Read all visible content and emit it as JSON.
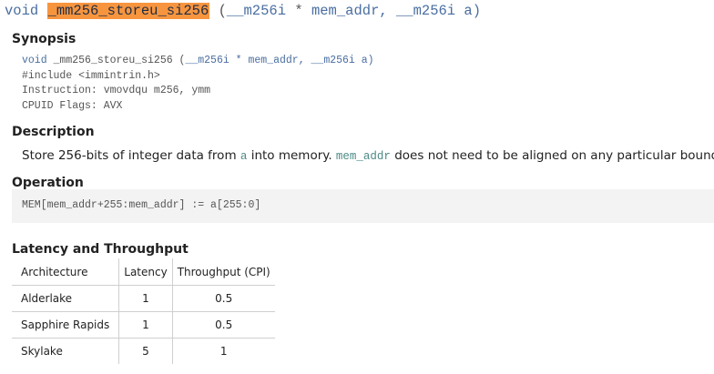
{
  "signature": {
    "ret_type": "void",
    "func_name": "_mm256_storeu_si256",
    "open_paren": "(",
    "param1_type": "__m256i",
    "param1_ptr": "*",
    "param1_name": "mem_addr,",
    "param2_type": "__m256i",
    "param2_name": "a)"
  },
  "synopsis": {
    "heading": "Synopsis",
    "line1_type": "void",
    "line1_name": "_mm256_storeu_si256",
    "line1_open": "(",
    "line1_p1": "__m256i",
    "line1_star": "*",
    "line1_p1name": "mem_addr,",
    "line1_p2": "__m256i",
    "line1_p2name": "a)",
    "include": "#include <immintrin.h>",
    "instruction": "Instruction: vmovdqu m256, ymm",
    "cpuid": "CPUID Flags: AVX"
  },
  "description": {
    "heading": "Description",
    "text_part1": "Store 256-bits of integer data from ",
    "code1": "a",
    "text_part2": " into memory. ",
    "code2": "mem_addr",
    "text_part3": " does not need to be aligned on any particular boundary."
  },
  "operation": {
    "heading": "Operation",
    "code": "MEM[mem_addr+255:mem_addr] := a[255:0]"
  },
  "latency": {
    "heading": "Latency and Throughput",
    "headers": [
      "Architecture",
      "Latency",
      "Throughput (CPI)"
    ],
    "rows": [
      [
        "Alderlake",
        "1",
        "0.5"
      ],
      [
        "Sapphire Rapids",
        "1",
        "0.5"
      ],
      [
        "Skylake",
        "5",
        "1"
      ]
    ]
  }
}
